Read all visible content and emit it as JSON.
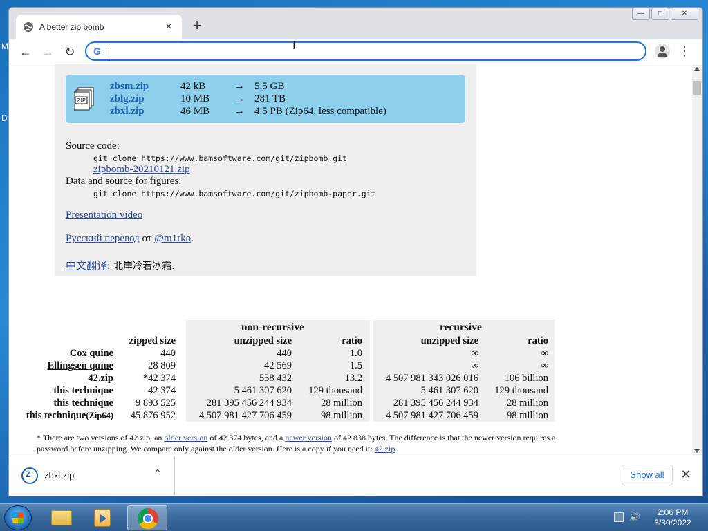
{
  "desktop": {
    "left_letters": [
      "M",
      "D"
    ]
  },
  "browser": {
    "tab_title": "A better zip bomb",
    "tab_close": "×",
    "new_tab": "+",
    "back": "←",
    "forward": "→",
    "reload": "↻",
    "omnibox_value": "",
    "omnibox_g": "G",
    "menu": "⋮",
    "window_controls": {
      "minimize": "—",
      "maximize": "□",
      "close": "✕"
    }
  },
  "page": {
    "downloads": [
      {
        "name": "zbsm.zip",
        "size": "42 kB",
        "arrow": "→",
        "out": "5.5 GB"
      },
      {
        "name": "zblg.zip",
        "size": "10 MB",
        "arrow": "→",
        "out": "281 TB"
      },
      {
        "name": "zbxl.zip",
        "size": "46 MB",
        "arrow": "→",
        "out": "4.5 PB (Zip64, less compatible)"
      }
    ],
    "source_label": "Source code:",
    "source_git": "git clone https://www.bamsoftware.com/git/zipbomb.git",
    "source_zip": "zipbomb-20210121.zip",
    "data_label": "Data and source for figures:",
    "data_git": "git clone https://www.bamsoftware.com/git/zipbomb-paper.git",
    "video_link": "Presentation video",
    "russian_link": "Русский перевод",
    "russian_from": " от ",
    "russian_author": "@m1rko",
    "russian_end": ".",
    "chinese_link": "中文翻译",
    "chinese_rest": ": 北岸冷若冰霜."
  },
  "table": {
    "group_headers": [
      "non-recursive",
      "recursive"
    ],
    "col_headers": [
      "zipped size",
      "unzipped size",
      "ratio",
      "unzipped size",
      "ratio"
    ],
    "rows": [
      {
        "label": "Cox quine",
        "link": true,
        "zipped": "440",
        "nr_unzipped": "440",
        "nr_ratio": "1.0",
        "r_unzipped": "∞",
        "r_ratio": "∞"
      },
      {
        "label": "Ellingsen quine",
        "link": true,
        "zipped": "28 809",
        "nr_unzipped": "42 569",
        "nr_ratio": "1.5",
        "r_unzipped": "∞",
        "r_ratio": "∞"
      },
      {
        "label": "42.zip",
        "link": true,
        "zipped": "*42 374",
        "nr_unzipped": "558 432",
        "nr_ratio": "13.2",
        "r_unzipped": "4 507 981 343 026 016",
        "r_ratio": "106 billion"
      },
      {
        "label": "this technique",
        "link": false,
        "zipped": "42 374",
        "nr_unzipped": "5 461 307 620",
        "nr_ratio": "129 thousand",
        "r_unzipped": "5 461 307 620",
        "r_ratio": "129 thousand"
      },
      {
        "label": "this technique",
        "link": false,
        "zipped": "9 893 525",
        "nr_unzipped": "281 395 456 244 934",
        "nr_ratio": "28 million",
        "r_unzipped": "281 395 456 244 934",
        "r_ratio": "28 million"
      },
      {
        "label": "this technique",
        "label_suffix": "(Zip64)",
        "link": false,
        "zipped": "45 876 952",
        "nr_unzipped": "4 507 981 427 706 459",
        "nr_ratio": "98 million",
        "r_unzipped": "4 507 981 427 706 459",
        "r_ratio": "98 million"
      }
    ],
    "footnote": {
      "p1": "* There are two versions of 42.zip, an ",
      "older": "older version",
      "p2": " of 42 374 bytes, and a ",
      "newer": "newer version",
      "p3": " of 42 838 bytes. The difference is that the newer version requires a password before unzipping. We compare only against the older version. Here is a copy if you need it: ",
      "copy": "42.zip",
      "p4": "."
    }
  },
  "shelf": {
    "file": "zbxl.zip",
    "chevron": "⌃",
    "show_all": "Show all",
    "close": "✕"
  },
  "taskbar": {
    "time": "2:06 PM",
    "date": "3/30/2022",
    "volume": "🔊"
  }
}
